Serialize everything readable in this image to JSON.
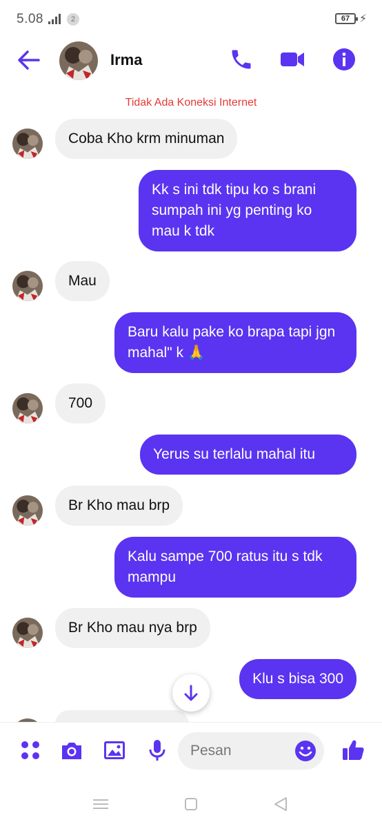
{
  "status_bar": {
    "time": "5.08",
    "sim": "2",
    "battery": "67"
  },
  "header": {
    "name": "Irma"
  },
  "banner": {
    "no_connection": "Tidak Ada Koneksi Internet"
  },
  "messages": [
    {
      "dir": "in",
      "text": "Coba Kho krm minuman"
    },
    {
      "dir": "out",
      "text": "Kk s ini tdk tipu ko s brani sumpah ini yg penting ko mau k tdk"
    },
    {
      "dir": "in",
      "text": "Mau"
    },
    {
      "dir": "out",
      "text": "Baru kalu pake ko brapa tapi jgn mahal\" k 🙏"
    },
    {
      "dir": "in",
      "text": "700"
    },
    {
      "dir": "out",
      "text": "Yerus su terlalu mahal itu"
    },
    {
      "dir": "in",
      "text": "Br Kho mau brp"
    },
    {
      "dir": "out",
      "text": "Kalu sampe 700 ratus itu s tdk mampu"
    },
    {
      "dir": "in",
      "text": "Br Kho mau nya brp"
    },
    {
      "dir": "out",
      "text": "Klu s bisa 300"
    }
  ],
  "composer": {
    "placeholder": "Pesan"
  },
  "colors": {
    "accent": "#5a34f0",
    "incoming_bubble": "#f0f0f0",
    "warning": "#e53935"
  },
  "icons": {
    "header": [
      "back-arrow-icon",
      "phone-icon",
      "video-camera-icon",
      "info-icon"
    ],
    "composer": [
      "apps-grid-icon",
      "camera-icon",
      "gallery-icon",
      "microphone-icon",
      "emoji-icon",
      "thumbs-up-icon"
    ]
  }
}
